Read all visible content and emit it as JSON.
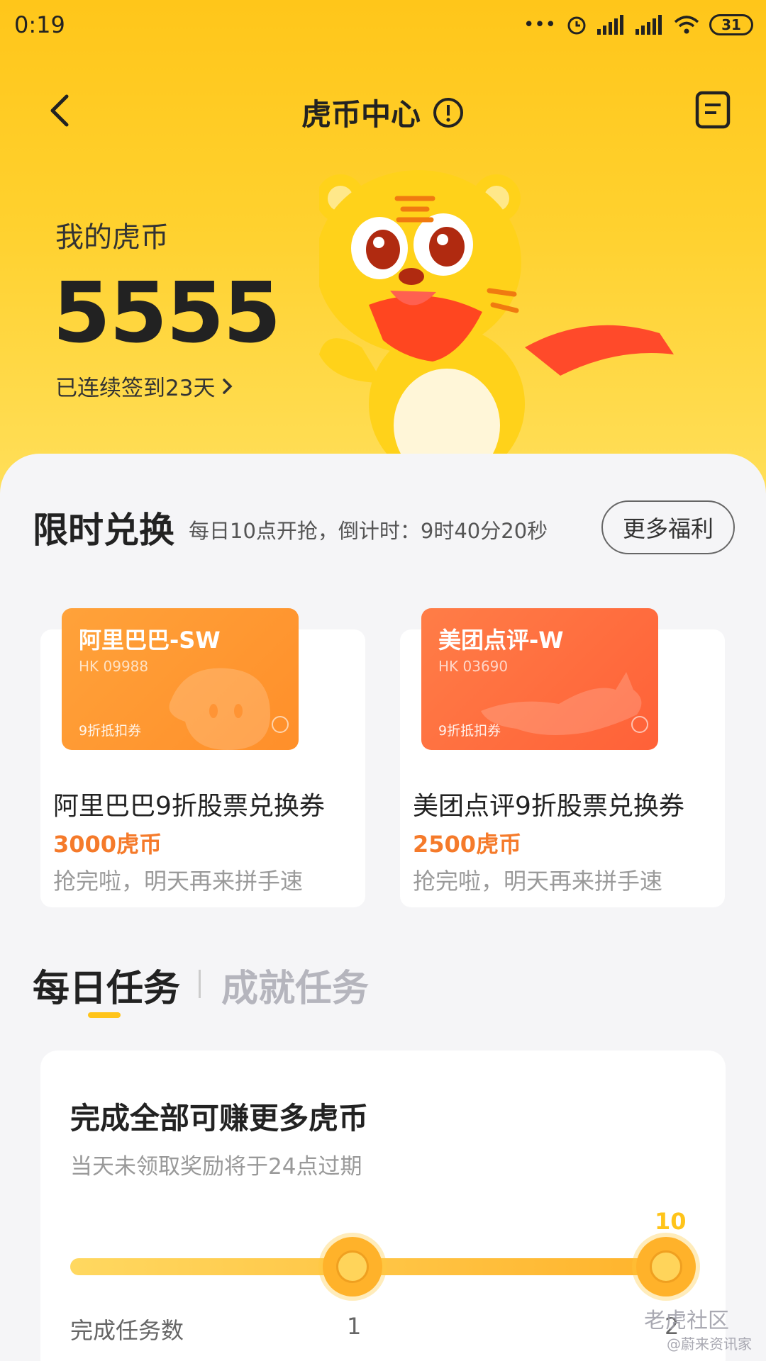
{
  "status_bar": {
    "time": "0:19",
    "signal": "•••",
    "battery": "31"
  },
  "nav": {
    "title": "虎币中心"
  },
  "wallet": {
    "label": "我的虎币",
    "coins": "5555",
    "streak": "已连续签到23天"
  },
  "flash_sale": {
    "title": "限时兑换",
    "countdown": "每日10点开抢，倒计时：9时40分20秒",
    "more_label": "更多福利",
    "items": [
      {
        "coupon_name": "阿里巴巴-SW",
        "coupon_code": "HK 09988",
        "coupon_type": "9折抵扣券",
        "title": "阿里巴巴9折股票兑换券",
        "price": "3000虎币",
        "status": "抢完啦，明天再来拼手速"
      },
      {
        "coupon_name": "美团点评-W",
        "coupon_code": "HK 03690",
        "coupon_type": "9折抵扣券",
        "title": "美团点评9折股票兑换券",
        "price": "2500虎币",
        "status": "抢完啦，明天再来拼手速"
      }
    ]
  },
  "tasks": {
    "tabs": [
      "每日任务",
      "成就任务"
    ],
    "active_tab": 0,
    "card": {
      "title": "完成全部可赚更多虎币",
      "subtitle": "当天未领取奖励将于24点过期",
      "reward": "10",
      "count_label": "完成任务数",
      "milestones": [
        "1",
        "2"
      ]
    }
  },
  "watermark": {
    "main": "老虎社区",
    "sub": "@蔚来资讯家"
  },
  "colors": {
    "brand_yellow": "#ffc61a",
    "price_orange": "#f57a2a",
    "alibaba_coupon": "#ff9a33",
    "meituan_coupon": "#ff6f3f"
  }
}
